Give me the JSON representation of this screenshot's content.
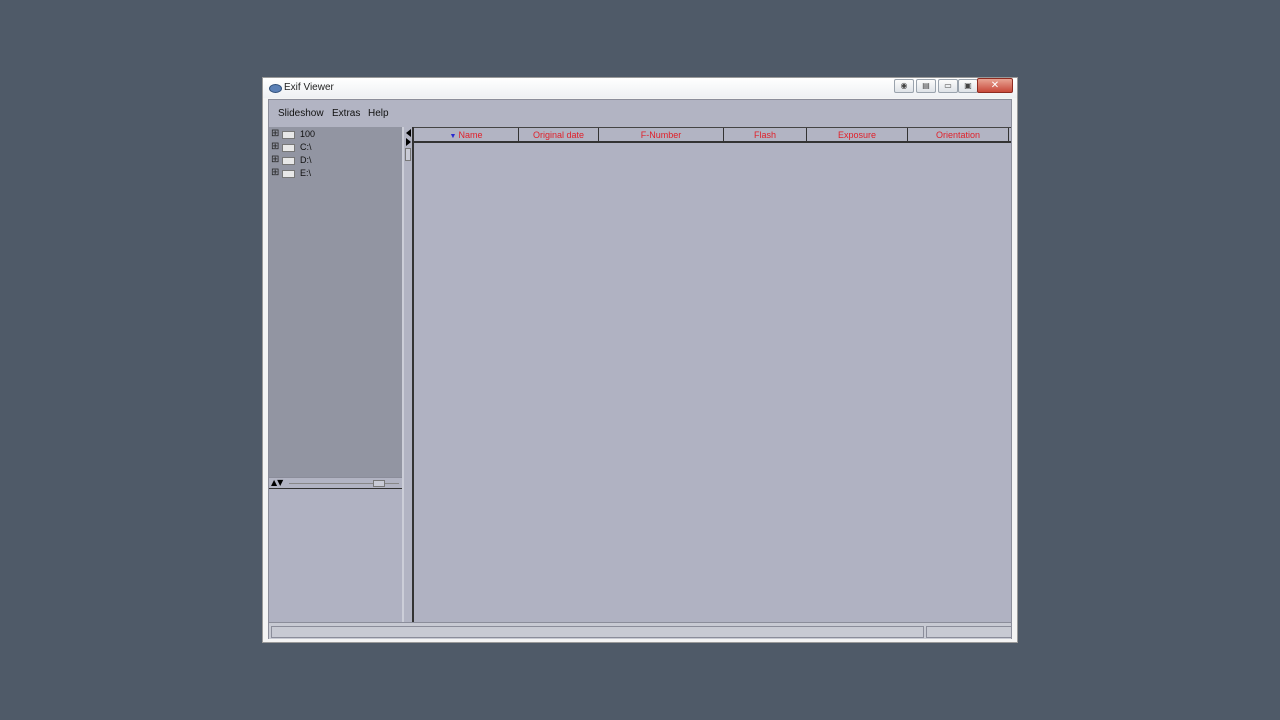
{
  "window": {
    "title": "Exif Viewer"
  },
  "titlebar": {
    "buttons": [
      "eye-icon",
      "edit-icon",
      "minimize-icon",
      "maximize-icon",
      "close-icon"
    ],
    "close_label": "✕"
  },
  "menu": {
    "items": [
      "Slideshow",
      "Extras",
      "Help"
    ]
  },
  "tree": {
    "nodes": [
      "100",
      "C:\\",
      "D:\\",
      "E:\\"
    ]
  },
  "table": {
    "columns": [
      "Name",
      "Original date",
      "F-Number",
      "Flash",
      "Exposure",
      "Orientation"
    ],
    "sorted_column": "Name",
    "sort_direction": "descending",
    "header_color": "#e0202a",
    "rows": []
  },
  "status": {
    "left": "",
    "right": ""
  }
}
